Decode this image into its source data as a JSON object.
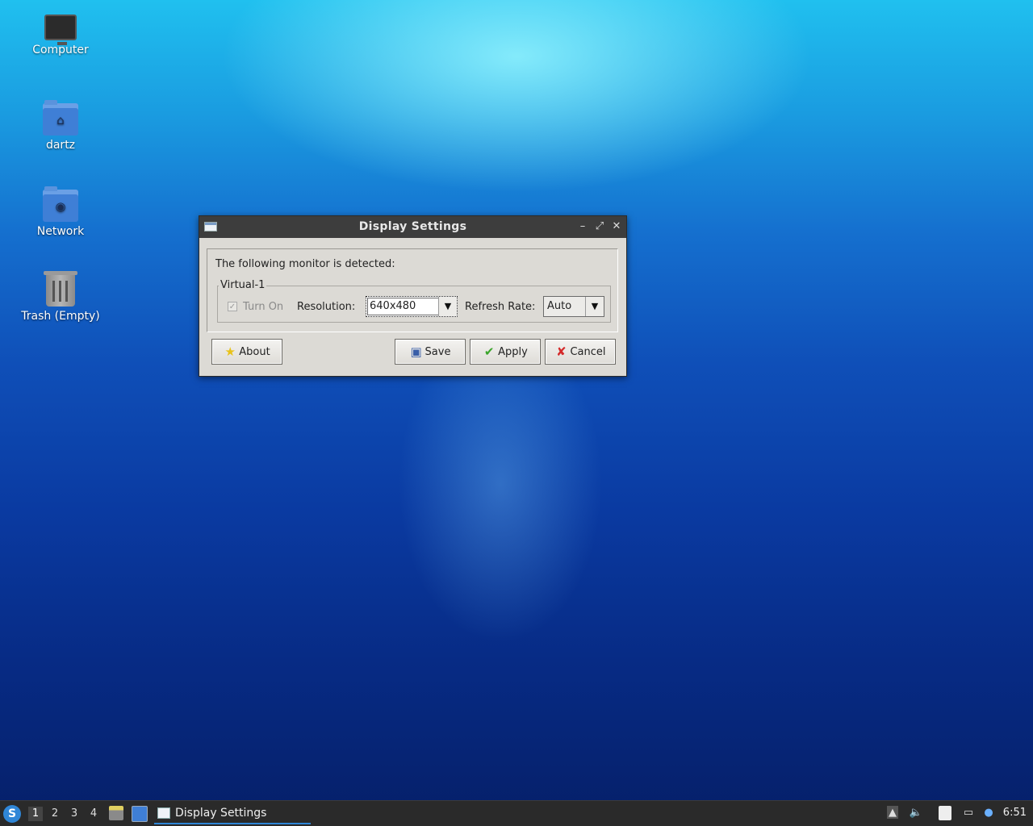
{
  "desktop": {
    "icons": [
      {
        "label": "Computer",
        "icon": "computer-icon"
      },
      {
        "label": "dartz",
        "icon": "home-folder-icon"
      },
      {
        "label": "Network",
        "icon": "network-folder-icon"
      },
      {
        "label": "Trash (Empty)",
        "icon": "trash-icon"
      }
    ]
  },
  "dialog": {
    "title": "Display Settings",
    "detected_text": "The following monitor is detected:",
    "monitor_name": "Virtual-1",
    "turn_on_label": "Turn On",
    "turn_on_checked": true,
    "resolution_label": "Resolution:",
    "resolution_value": "640x480",
    "refresh_label": "Refresh Rate:",
    "refresh_value": "Auto",
    "buttons": {
      "about": "About",
      "save": "Save",
      "apply": "Apply",
      "cancel": "Cancel"
    }
  },
  "taskbar": {
    "workspaces": [
      "1",
      "2",
      "3",
      "4"
    ],
    "active_workspace": "1",
    "task_label": "Display Settings",
    "clock": "6:51"
  },
  "colors": {
    "accent": "#2f86d7",
    "titlebar": "#3d3d3d",
    "dialog_bg": "#dcdad5",
    "taskbar_bg": "#2a2a2a"
  }
}
